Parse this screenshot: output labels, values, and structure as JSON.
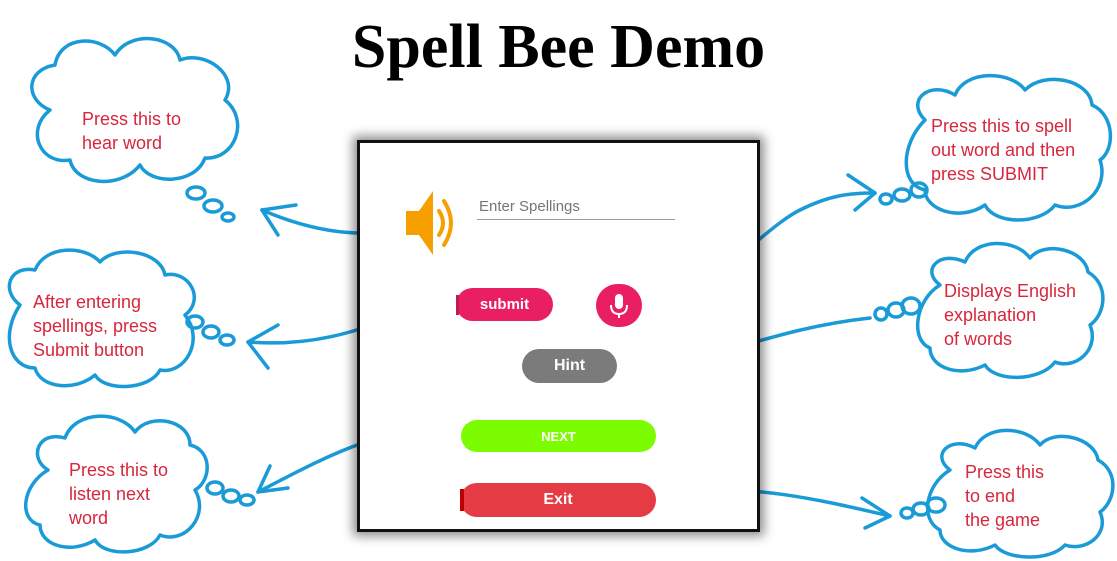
{
  "title": "Spell Bee Demo",
  "colors": {
    "cloud_outline": "#1a9bd7",
    "note_text": "#d7263d",
    "submit": "#e91e63",
    "mic": "#e91e63",
    "hint": "#7b7b7b",
    "next": "#7cfc00",
    "exit": "#e53b44",
    "speaker": "#f5a000"
  },
  "notes": {
    "hear_word": "Press this to\nhear word",
    "submit_button": "After entering\nspellings, press\nSubmit button",
    "listen_next": "Press this to\nlisten next\nword",
    "spell_out": "Press this to spell\nout word and then\npress SUBMIT",
    "hint_explain": "Displays English\nexplanation\nof words",
    "end_game": "Press this\nto end\nthe game"
  },
  "app": {
    "speaker_icon": "speaker-icon",
    "input_placeholder": "Enter Spellings",
    "submit_label": "submit",
    "mic_icon": "microphone-icon",
    "hint_label": "Hint",
    "next_label": "NEXT",
    "exit_label": "Exit"
  }
}
